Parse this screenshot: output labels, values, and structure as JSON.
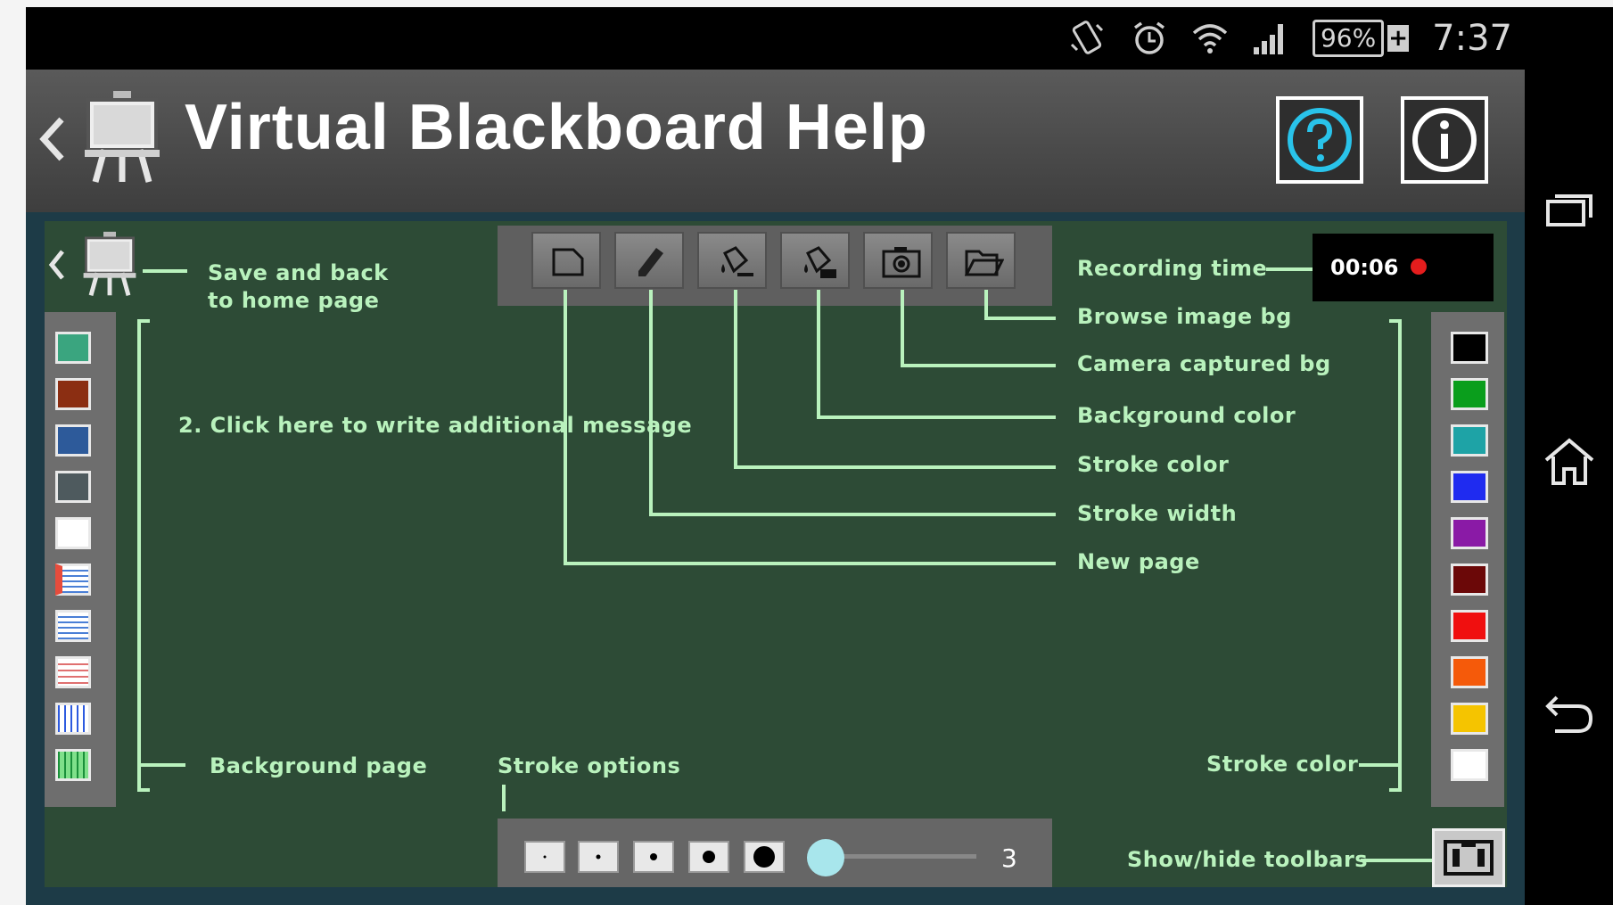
{
  "status_bar": {
    "battery_label": "96%",
    "battery_plus": "+",
    "time": "7:37",
    "icons": [
      "vibrate-icon",
      "alarm-icon",
      "wifi-icon",
      "signal-icon",
      "battery-icon"
    ]
  },
  "app_bar": {
    "title": "Virtual Blackboard Help",
    "help_icon": "help-icon",
    "info_icon": "info-icon",
    "help_color": "#29c3ea"
  },
  "board": {
    "save_back_line1": "Save and back",
    "save_back_line2": "to home page",
    "additional_message": "2. Click here to write additional message",
    "background_page": "Background page",
    "stroke_options": "Stroke options",
    "stroke_color_bottom": "Stroke color",
    "show_hide_toolbars": "Show/hide toolbars",
    "recording_time_label": "Recording time",
    "recording_time": "00:06",
    "toolbar_callouts": {
      "browse_image_bg": "Browse image bg",
      "camera_captured_bg": "Camera captured bg",
      "background_color": "Background color",
      "stroke_color": "Stroke color",
      "stroke_width": "Stroke width",
      "new_page": "New page"
    },
    "stroke_width_value": "3",
    "board_color": "#2d4b36",
    "label_color": "#b9f2bd"
  },
  "top_toolbar": {
    "buttons": [
      "new-page-icon",
      "pencil-icon",
      "stroke-color-bucket-icon",
      "background-color-bucket-icon",
      "camera-icon",
      "folder-icon"
    ]
  },
  "left_toolbar": {
    "swatches": [
      "#3aa57f",
      "#8b2e12",
      "#2d5a9a",
      "#4e5a5e",
      "#ffffff",
      "lined-paper-1",
      "lined-paper-2",
      "lined-paper-3",
      "grid-blue",
      "grid-green"
    ]
  },
  "right_toolbar": {
    "colors": [
      "#000000",
      "#0a9e1c",
      "#1ea3a6",
      "#1f2bf0",
      "#8a1aa6",
      "#6b0808",
      "#f00f0f",
      "#f55a0a",
      "#f5c400",
      "#ffffff"
    ]
  },
  "nav_bar": {
    "icons": [
      "recent-apps-icon",
      "home-icon",
      "back-icon"
    ]
  }
}
